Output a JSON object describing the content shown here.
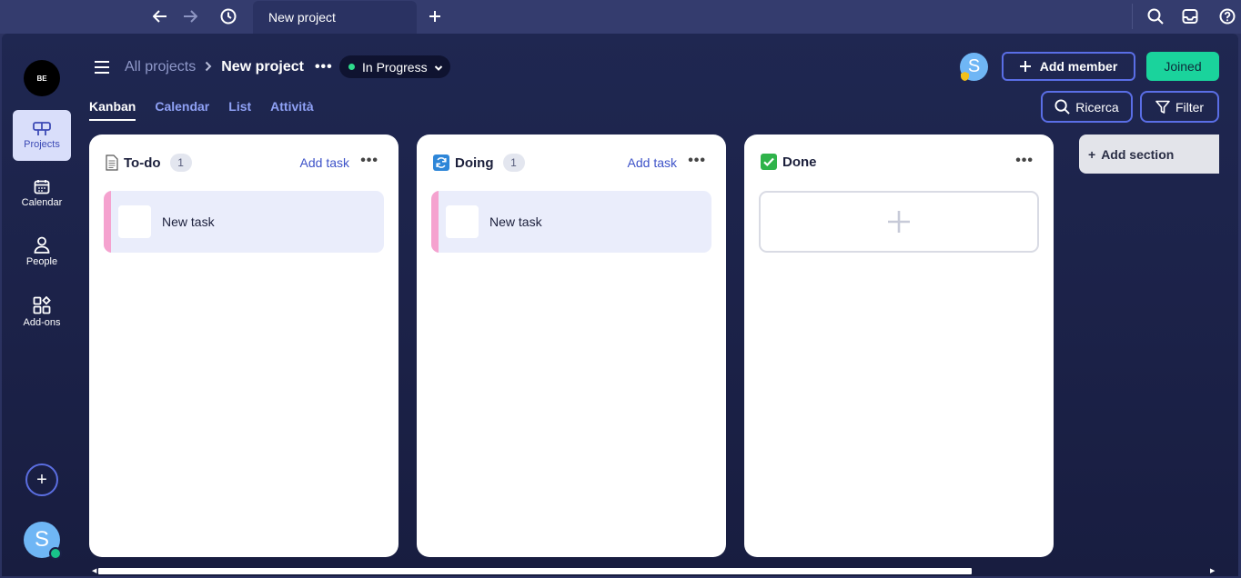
{
  "titlebar": {
    "tab_label": "New project",
    "new_tab_icon": "plus-icon",
    "back_icon": "arrow-left-icon",
    "forward_icon": "arrow-right-icon",
    "history_icon": "clock-icon"
  },
  "rail": {
    "logo_text": "BE",
    "items": [
      {
        "label": "Projects",
        "icon": "board-icon",
        "active": true
      },
      {
        "label": "Calendar",
        "icon": "calendar-icon"
      },
      {
        "label": "People",
        "icon": "person-icon"
      },
      {
        "label": "Add-ons",
        "icon": "addons-icon"
      }
    ],
    "add_label": "+",
    "avatar_letter": "S"
  },
  "header": {
    "breadcrumb_all": "All projects",
    "breadcrumb_current": "New project",
    "more": "•••",
    "status": "In Progress",
    "avatar_letter": "S",
    "add_member": "Add member",
    "joined": "Joined"
  },
  "views": {
    "tabs": [
      "Kanban",
      "Calendar",
      "List",
      "Attività"
    ],
    "active": "Kanban",
    "search_label": "Ricerca",
    "filter_label": "Filter"
  },
  "columns": [
    {
      "title": "To-do",
      "icon": "page-icon",
      "count": "1",
      "add_task": "Add task",
      "tasks": [
        {
          "name": "New task"
        }
      ]
    },
    {
      "title": "Doing",
      "icon": "refresh-icon",
      "count": "1",
      "add_task": "Add task",
      "tasks": [
        {
          "name": "New task"
        }
      ]
    },
    {
      "title": "Done",
      "icon": "checkmark-icon",
      "tasks": []
    }
  ],
  "more_menu": "•••",
  "add_section": "Add section",
  "colors": {
    "accent": "#5a6ee6",
    "joined": "#1ad39c",
    "status_dot": "#2fdc8c",
    "task_bar": "#f5a2cf"
  }
}
